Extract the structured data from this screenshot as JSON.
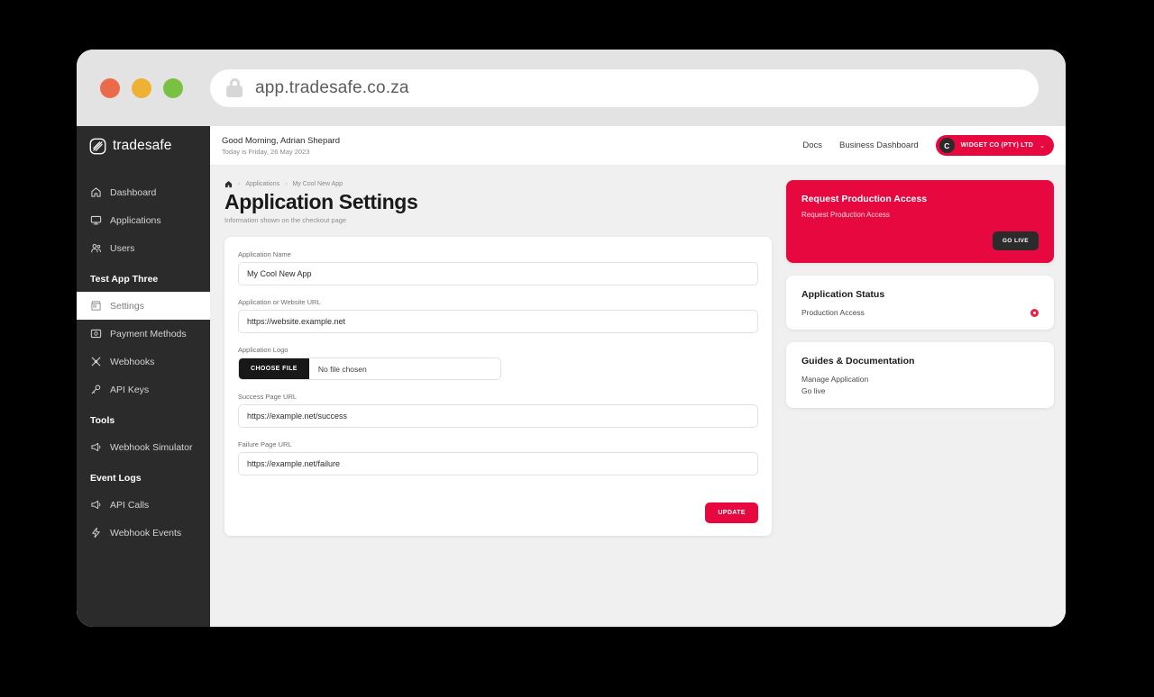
{
  "browser": {
    "url": "app.tradesafe.co.za",
    "lock_icon": "lock-icon",
    "traffic_lights": [
      "close-red",
      "minimize-yellow",
      "maximize-green"
    ]
  },
  "sidebar": {
    "brand": "tradesafe",
    "items": [
      {
        "label": "Dashboard",
        "icon": "home-icon",
        "type": "link",
        "active": false
      },
      {
        "label": "Applications",
        "icon": "monitor-icon",
        "type": "link",
        "active": false
      },
      {
        "label": "Users",
        "icon": "users-icon",
        "type": "link",
        "active": false
      },
      {
        "label": "Test App Three",
        "icon": "",
        "type": "section",
        "active": false
      },
      {
        "label": "Settings",
        "icon": "store-icon",
        "type": "link",
        "active": true
      },
      {
        "label": "Payment Methods",
        "icon": "card-icon",
        "type": "link",
        "active": false
      },
      {
        "label": "Webhooks",
        "icon": "shuffle-icon",
        "type": "link",
        "active": false
      },
      {
        "label": "API Keys",
        "icon": "key-icon",
        "type": "link",
        "active": false
      },
      {
        "label": "Tools",
        "icon": "",
        "type": "section",
        "active": false
      },
      {
        "label": "Webhook Simulator",
        "icon": "megaphone-icon",
        "type": "link",
        "active": false
      },
      {
        "label": "Event Logs",
        "icon": "",
        "type": "section",
        "active": false
      },
      {
        "label": "API Calls",
        "icon": "megaphone-icon",
        "type": "link",
        "active": false
      },
      {
        "label": "Webhook Events",
        "icon": "bolt-icon",
        "type": "link",
        "active": false
      }
    ]
  },
  "topbar": {
    "greeting": "Good Morning, Adrian Shepard",
    "date_line": "Today is Friday, 26 May 2023",
    "docs_label": "Docs",
    "business_dashboard_label": "Business Dashboard",
    "org_initial": "C",
    "org_name": "WIDGET CO (PTY) LTD",
    "org_caret": "⌄"
  },
  "page": {
    "breadcrumb": {
      "home_icon": "home-icon",
      "separator": "›",
      "items": [
        "Applications",
        "My Cool New App"
      ]
    },
    "title": "Application Settings",
    "subtitle": "Information shown on the checkout page"
  },
  "form": {
    "fields": [
      {
        "label": "Application Name",
        "value": "My Cool New App",
        "placeholder": "Application Name",
        "type": "text"
      },
      {
        "label": "Application or Website URL",
        "value": "https://website.example.net",
        "placeholder": "https://",
        "type": "text"
      },
      {
        "label": "Application Logo",
        "type": "file",
        "button_label": "CHOOSE FILE",
        "file_status": "No file chosen"
      },
      {
        "label": "Success Page URL",
        "value": "https://example.net/success",
        "placeholder": "https://",
        "type": "text"
      },
      {
        "label": "Failure Page URL",
        "value": "https://example.net/failure",
        "placeholder": "https://",
        "type": "text"
      }
    ],
    "submit_label": "UPDATE"
  },
  "rail": {
    "promo": {
      "title": "Request Production Access",
      "subtitle": "Request Production Access",
      "button_label": "GO LIVE"
    },
    "status": {
      "title": "Application Status",
      "row_label": "Production Access",
      "indicator": "status-dot-red"
    },
    "guides": {
      "title": "Guides & Documentation",
      "links": [
        "Manage Application",
        "Go live"
      ]
    }
  },
  "colors": {
    "brand_red": "#e6083f",
    "sidebar_dark": "#2b2b2b",
    "page_bg": "#f0f0f0",
    "status_red": "#f01f3f"
  }
}
